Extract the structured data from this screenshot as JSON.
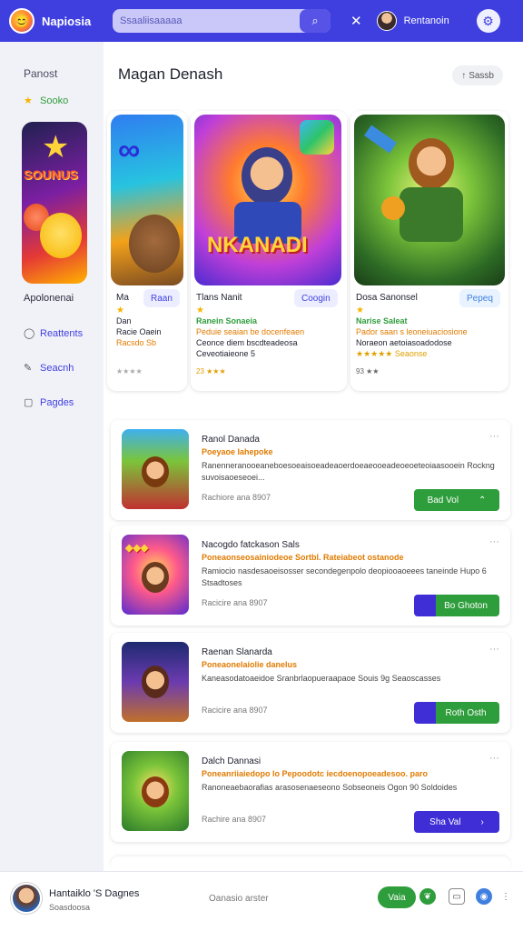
{
  "topbar": {
    "app_name": "Napiosia",
    "search_placeholder": "Ssaaliisaaaaa",
    "user_name": "Rentanoin"
  },
  "sidebar": {
    "title": "Panost",
    "items": [
      {
        "label": "Sooko",
        "icon": "star-icon"
      },
      {
        "label": "Reattents",
        "icon": "circle-icon"
      },
      {
        "label": "Seacnh",
        "icon": "pencil-icon"
      },
      {
        "label": "Pagdes",
        "icon": "folder-icon"
      }
    ],
    "section_label": "Apolonenai",
    "cover_text": "SOUNUS"
  },
  "main": {
    "title": "Magan Denash",
    "filter_label": "Sassb",
    "featured": [
      {
        "name": "Ma",
        "pill": "Raan",
        "line1": "Dan",
        "line2": "Racie Oaein",
        "line3": "Racsdo Sb",
        "meta": "★★★★"
      },
      {
        "name": "Tlans Nanit",
        "pill": "Coogin",
        "art_text": "NKANADI",
        "line1": "Ranein Sonaeia",
        "line2": "Peduie seaian be docenfeaen",
        "line3": "Ceonce diem bscdteadeosa",
        "line4": "Ceveotiaieone 5",
        "meta": "23 ★★★"
      },
      {
        "name": "Dosa Sanonsel",
        "pill": "Pepeq",
        "line1": "Narise Saleat",
        "line2": "Pador saan s leoneiuaciosione",
        "line3": "Noraeon aetoiasoadodose",
        "line4": "★★★★★ Seaonse",
        "meta": "93 ★★"
      }
    ],
    "list": [
      {
        "title": "Ranol Danada",
        "sub": "Poeyaoe Iahepoke",
        "desc": "Ranenneranooeaneboesoeaisoeadeaoerdoeaeooeadeoeoeteoiaasooein Rockng suvoisaoeseoei...",
        "meta": "Rachiore ana 8907",
        "btn": "Bad Vol",
        "btn_color": "#2e9d3b"
      },
      {
        "title": "Nacogdo fatckason Sals",
        "sub": "Poneaonseosainiodeoe Sortbl. Rateiabeot ostanode",
        "desc": "Ramiocio nasdesaoeisosser secondegenpolo deopiooaoeees taneinde Hupo 6 Stsadtoses",
        "meta": "Racicire ana 8907",
        "btn": "Bo Ghoton",
        "btn_color": "#2e9d3b"
      },
      {
        "title": "Raenan Slanarda",
        "sub": "Poneaonelaiolie danelus",
        "desc": "Kaneasodatoaeidoe Sranbrlaopueraapaoe Souis 9g Seaoscasses",
        "meta": "Racicire ana 8907",
        "btn": "Roth Osth",
        "btn_color": "#2e9d3b"
      },
      {
        "title": "Dalch Dannasi",
        "sub": "Poneanriiaiedopo lo Pepoodotc iecdoenopoeadesoo. paro",
        "desc": "Ranoneaebaorafias arasosenaeseono Sobseoneis Ogon 90 Soldoides",
        "meta": "Rachire ana 8907",
        "btn": "Sha Val",
        "btn_color": "#3f2ed6"
      }
    ]
  },
  "bottombar": {
    "name": "Hantaiklo 'S Dagnes",
    "sub": "Soasdoosa",
    "status": "Oanasio arster",
    "play_label": "Vaia"
  },
  "colors": {
    "primary": "#3f3fe0",
    "green": "#2e9d3b",
    "orange": "#e07b00",
    "purple": "#3f2ed6"
  }
}
